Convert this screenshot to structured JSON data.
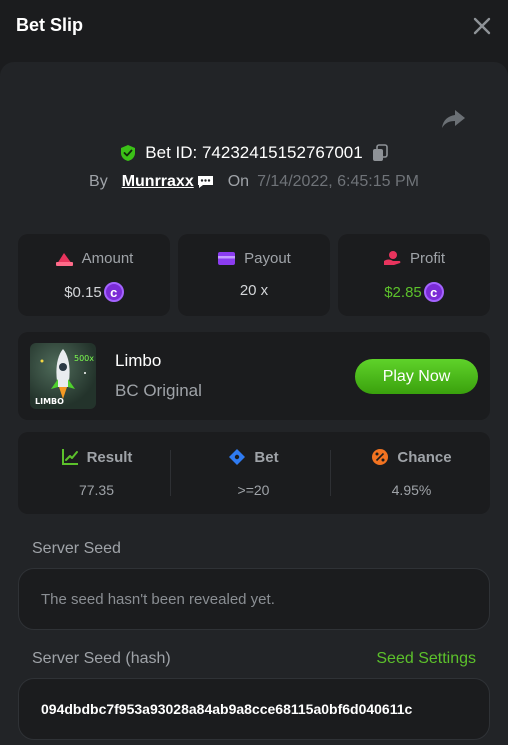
{
  "header": {
    "title": "Bet Slip"
  },
  "bet": {
    "id_label": "Bet ID: 74232415152767001",
    "by_label": "By",
    "user": "Munrraxx",
    "on_label": "On",
    "date": "7/14/2022, 6:45:15 PM"
  },
  "stats": {
    "amount": {
      "label": "Amount",
      "value": "$0.15"
    },
    "payout": {
      "label": "Payout",
      "value": "20 x"
    },
    "profit": {
      "label": "Profit",
      "value": "$2.85"
    }
  },
  "game": {
    "name": "Limbo",
    "subtitle": "BC Original",
    "play_label": "Play Now",
    "thumb_text": "LIMBO",
    "thumb_badge": "500x"
  },
  "result_box": {
    "result": {
      "label": "Result",
      "value": "77.35"
    },
    "bet": {
      "label": "Bet",
      "value": ">=20"
    },
    "chance": {
      "label": "Chance",
      "value": "4.95%"
    }
  },
  "server_seed": {
    "label": "Server Seed",
    "value": "The seed hasn't been revealed yet."
  },
  "server_seed_hash": {
    "label": "Server Seed (hash)",
    "settings_label": "Seed Settings",
    "value": "094dbdbc7f953a93028a84ab9a8cce68115a0bf6d040611c"
  },
  "colors": {
    "accent_green": "#5cc12b",
    "coin_purple": "#7b2cd6",
    "profit_green": "#5cc12b"
  }
}
